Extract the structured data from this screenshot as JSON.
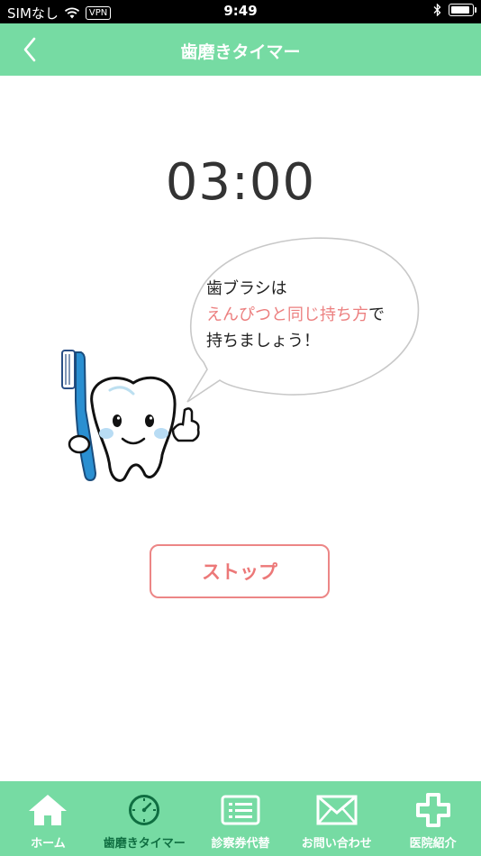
{
  "status_bar": {
    "carrier": "SIMなし",
    "vpn": "VPN",
    "time": "9:49"
  },
  "nav": {
    "title": "歯磨きタイマー"
  },
  "timer": {
    "display": "03:00"
  },
  "bubble": {
    "line1": "歯ブラシは",
    "line2_highlight": "えんぴつと同じ持ち方",
    "line2_rest": "で",
    "line3": "持ちましょう！"
  },
  "stop_button": {
    "label": "ストップ"
  },
  "tabs": [
    {
      "label": "ホーム",
      "icon": "home-icon",
      "active": false
    },
    {
      "label": "歯磨きタイマー",
      "icon": "timer-icon",
      "active": true
    },
    {
      "label": "診察券代替",
      "icon": "card-icon",
      "active": false
    },
    {
      "label": "お問い合わせ",
      "icon": "mail-icon",
      "active": false
    },
    {
      "label": "医院紹介",
      "icon": "clinic-cross-icon",
      "active": false
    }
  ],
  "colors": {
    "accent": "#76dba3",
    "active_tab": "#0f6e41",
    "highlight_text": "#ec7f7f",
    "stop_border": "#ec8686"
  }
}
